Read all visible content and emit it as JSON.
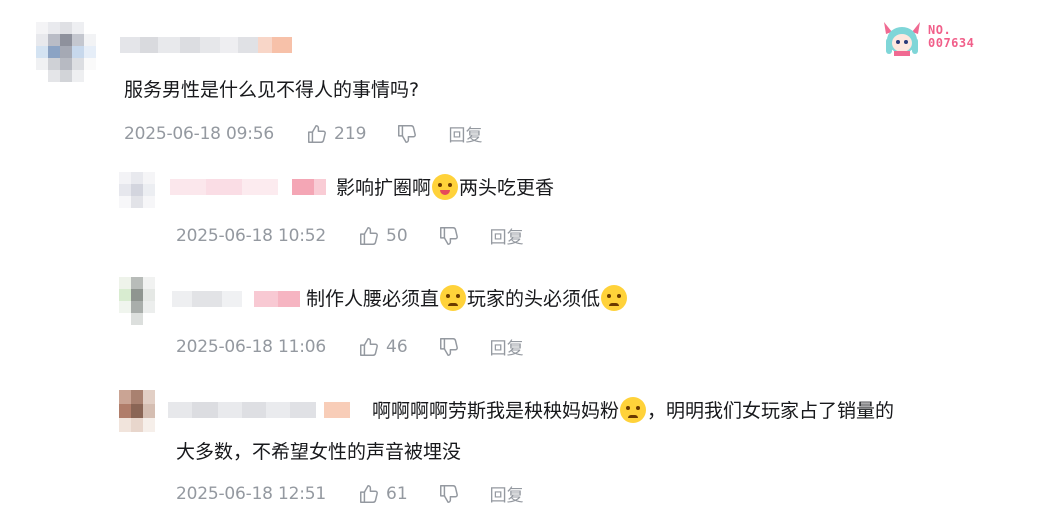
{
  "badge": {
    "line1": "NO.",
    "line2": "007634"
  },
  "comments": [
    {
      "content": "服务男性是什么见不得人的事情吗?",
      "time": "2025-06-18 09:56",
      "likes": "219",
      "reply_label": "回复"
    },
    {
      "content_a": "影响扩圈啊",
      "content_b": "两头吃更香",
      "time": "2025-06-18 10:52",
      "likes": "50",
      "reply_label": "回复"
    },
    {
      "content_a": "制作人腰必须直",
      "content_b": "玩家的头必须低",
      "time": "2025-06-18 11:06",
      "likes": "46",
      "reply_label": "回复"
    },
    {
      "content_a": "啊啊啊啊劳斯我是秧秧妈妈粉",
      "content_b": "，明明我们女玩家占了销量的",
      "content_line2": "大多数，不希望女性的声音被埋没",
      "time": "2025-06-18 12:51",
      "likes": "61",
      "reply_label": "回复"
    }
  ]
}
